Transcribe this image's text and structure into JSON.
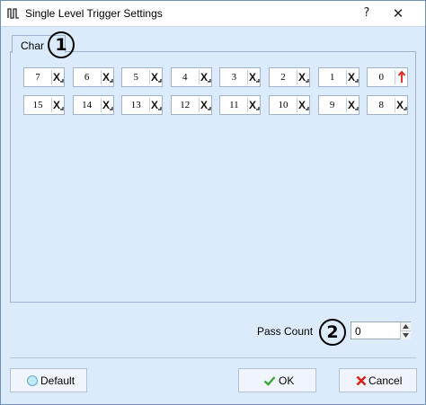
{
  "window": {
    "title": "Single Level Trigger Settings",
    "title_icon": "pulse-wave-icon",
    "help_label": "?",
    "close_label": "✕"
  },
  "tab": {
    "label": "Char"
  },
  "annotations": {
    "marker_1": "1",
    "marker_2": "2"
  },
  "bits_row1": [
    {
      "label": "7",
      "state": "dont-care-icon"
    },
    {
      "label": "6",
      "state": "dont-care-icon"
    },
    {
      "label": "5",
      "state": "dont-care-icon"
    },
    {
      "label": "4",
      "state": "dont-care-icon"
    },
    {
      "label": "3",
      "state": "dont-care-icon"
    },
    {
      "label": "2",
      "state": "dont-care-icon"
    },
    {
      "label": "1",
      "state": "dont-care-icon"
    },
    {
      "label": "0",
      "state": "rising-edge-icon"
    }
  ],
  "bits_row2": [
    {
      "label": "15",
      "state": "dont-care-icon"
    },
    {
      "label": "14",
      "state": "dont-care-icon"
    },
    {
      "label": "13",
      "state": "dont-care-icon"
    },
    {
      "label": "12",
      "state": "dont-care-icon"
    },
    {
      "label": "11",
      "state": "dont-care-icon"
    },
    {
      "label": "10",
      "state": "dont-care-icon"
    },
    {
      "label": "9",
      "state": "dont-care-icon"
    },
    {
      "label": "8",
      "state": "dont-care-icon"
    }
  ],
  "pass_count": {
    "label": "Pass Count",
    "value": "0"
  },
  "buttons": {
    "default_label": "Default",
    "ok_label": "OK",
    "cancel_label": "Cancel"
  },
  "colors": {
    "dialog_background": "#dcebfb",
    "rising_edge": "#e02020",
    "ok_check": "#3aa53a",
    "cancel_x": "#d42020",
    "default_dot": "#bfe9f4"
  }
}
